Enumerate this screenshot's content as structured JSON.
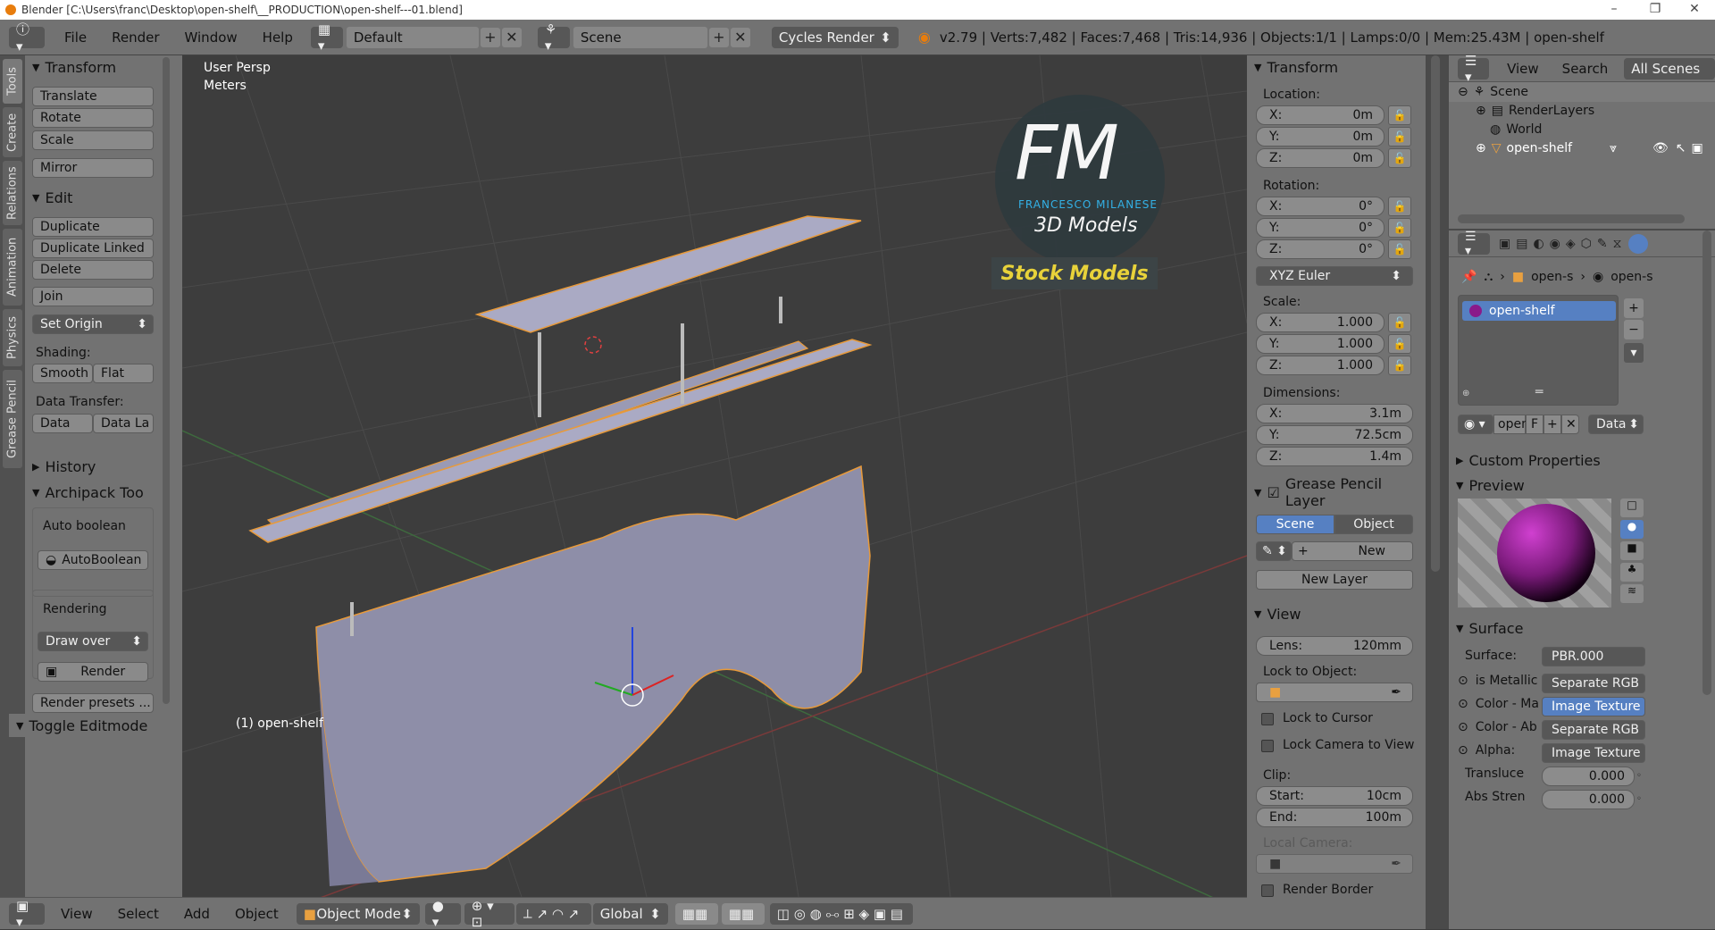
{
  "window": {
    "title": "Blender [C:\\Users\\franc\\Desktop\\open-shelf\\__PRODUCTION\\open-shelf---01.blend]"
  },
  "topbar": {
    "menus": [
      "File",
      "Render",
      "Window",
      "Help"
    ],
    "layout": "Default",
    "scene": "Scene",
    "engine": "Cycles Render",
    "stats": "v2.79 | Verts:7,482 | Faces:7,468 | Tris:14,936 | Objects:1/1 | Lamps:0/0 | Mem:25.43M | open-shelf"
  },
  "left_tabs": [
    "Tools",
    "Create",
    "Relations",
    "Animation",
    "Physics",
    "Grease Pencil"
  ],
  "toolshelf": {
    "transform_title": "Transform",
    "translate": "Translate",
    "rotate": "Rotate",
    "scale": "Scale",
    "mirror": "Mirror",
    "edit_title": "Edit",
    "duplicate": "Duplicate",
    "duplicate_linked": "Duplicate Linked",
    "delete": "Delete",
    "join": "Join",
    "set_origin": "Set Origin",
    "shading_label": "Shading:",
    "smooth": "Smooth",
    "flat": "Flat",
    "data_transfer_label": "Data Transfer:",
    "data": "Data",
    "data_la": "Data La",
    "history_title": "History",
    "archipack_title": "Archipack Too",
    "auto_boolean_label": "Auto boolean",
    "autoboolean_btn": "AutoBoolean",
    "rendering_label": "Rendering",
    "draw_over": "Draw over",
    "render_btn": "Render",
    "render_presets": "Render presets ...",
    "toggle_editmode": "Toggle Editmode"
  },
  "viewport": {
    "view_name": "User Persp",
    "units": "Meters",
    "object_label": "(1) open-shelf",
    "watermark": {
      "initials": "FM",
      "name": "FRANCESCO MILANESE",
      "subtitle": "3D Models",
      "banner": "Stock Models"
    }
  },
  "bottombar": {
    "menus": [
      "View",
      "Select",
      "Add",
      "Object"
    ],
    "mode": "Object Mode",
    "orientation": "Global"
  },
  "npanel": {
    "transform_title": "Transform",
    "location_label": "Location:",
    "location": [
      {
        "axis": "X:",
        "value": "0m"
      },
      {
        "axis": "Y:",
        "value": "0m"
      },
      {
        "axis": "Z:",
        "value": "0m"
      }
    ],
    "rotation_label": "Rotation:",
    "rotation": [
      {
        "axis": "X:",
        "value": "0°"
      },
      {
        "axis": "Y:",
        "value": "0°"
      },
      {
        "axis": "Z:",
        "value": "0°"
      }
    ],
    "rotation_mode": "XYZ Euler",
    "scale_label": "Scale:",
    "scale": [
      {
        "axis": "X:",
        "value": "1.000"
      },
      {
        "axis": "Y:",
        "value": "1.000"
      },
      {
        "axis": "Z:",
        "value": "1.000"
      }
    ],
    "dimensions_label": "Dimensions:",
    "dimensions": [
      {
        "axis": "X:",
        "value": "3.1m"
      },
      {
        "axis": "Y:",
        "value": "72.5cm"
      },
      {
        "axis": "Z:",
        "value": "1.4m"
      }
    ],
    "grease_title": "Grease Pencil Layer",
    "scene_tab": "Scene",
    "object_tab": "Object",
    "new_btn": "New",
    "new_layer_btn": "New Layer",
    "view_title": "View",
    "lens_label": "Lens:",
    "lens_value": "120mm",
    "lock_to_object_label": "Lock to Object:",
    "lock_to_cursor": "Lock to Cursor",
    "lock_camera": "Lock Camera to View",
    "clip_label": "Clip:",
    "clip_start_label": "Start:",
    "clip_start": "10cm",
    "clip_end_label": "End:",
    "clip_end": "100m",
    "local_camera_label": "Local Camera:",
    "render_border": "Render Border"
  },
  "outliner": {
    "view": "View",
    "search": "Search",
    "filter": "All Scenes",
    "items": [
      "Scene",
      "RenderLayers",
      "World",
      "open-shelf"
    ]
  },
  "properties": {
    "breadcrumb_1": "open-s",
    "breadcrumb_2": "open-s",
    "material_slot": "open-shelf",
    "mat_name": "open-",
    "mat_f": "F",
    "data_select": "Data",
    "custom_props": "Custom Properties",
    "preview": "Preview",
    "surface_title": "Surface",
    "surface_label": "Surface:",
    "surface_value": "PBR.000",
    "inputs": [
      {
        "label": "is Metallic",
        "value": "Separate RGB"
      },
      {
        "label": "Color - Ma",
        "value": "Image Texture"
      },
      {
        "label": "Color - Ab",
        "value": "Separate RGB"
      },
      {
        "label": "Alpha:",
        "value": "Image Texture"
      }
    ],
    "translucency_label": "Transluce",
    "translucency_value": "0.000",
    "abs_label": "Abs Stren",
    "abs_value": "0.000"
  }
}
